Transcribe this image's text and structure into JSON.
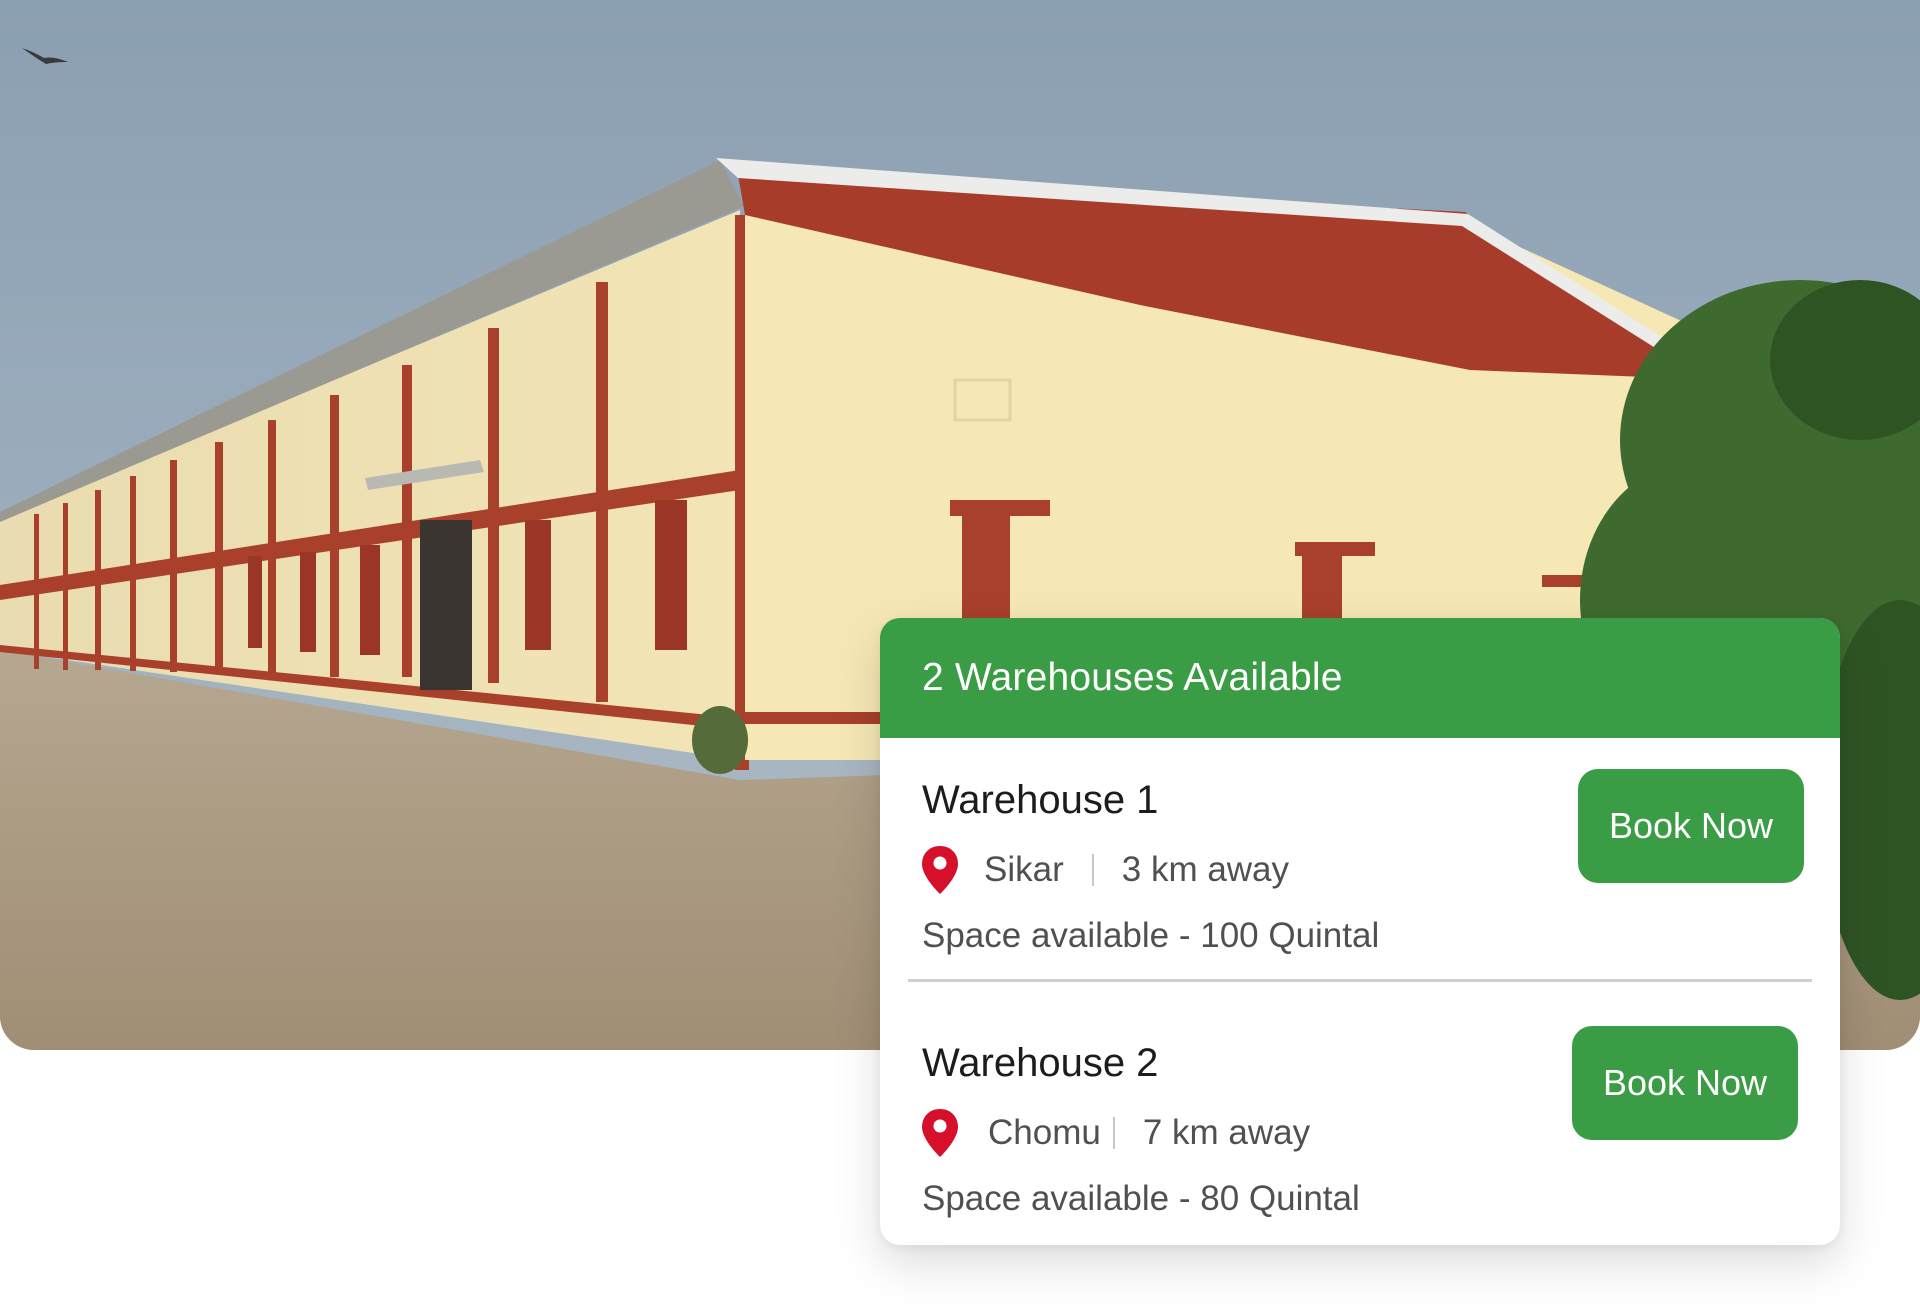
{
  "card": {
    "header": "2 Warehouses Available",
    "warehouses": [
      {
        "name": "Warehouse 1",
        "city": "Sikar",
        "distance": "3 km away",
        "space": "Space available - 100 Quintal",
        "button": "Book Now"
      },
      {
        "name": "Warehouse 2",
        "city": "Chomu",
        "distance": "7 km away",
        "space": "Space available - 80 Quintal",
        "button": "Book Now"
      }
    ]
  },
  "colors": {
    "accent_green": "#3a9c44",
    "pin_red": "#d6102b",
    "roof_red": "#a83c2a",
    "wall_cream": "#f6e8b4"
  },
  "icons": [
    "location-pin-icon"
  ]
}
